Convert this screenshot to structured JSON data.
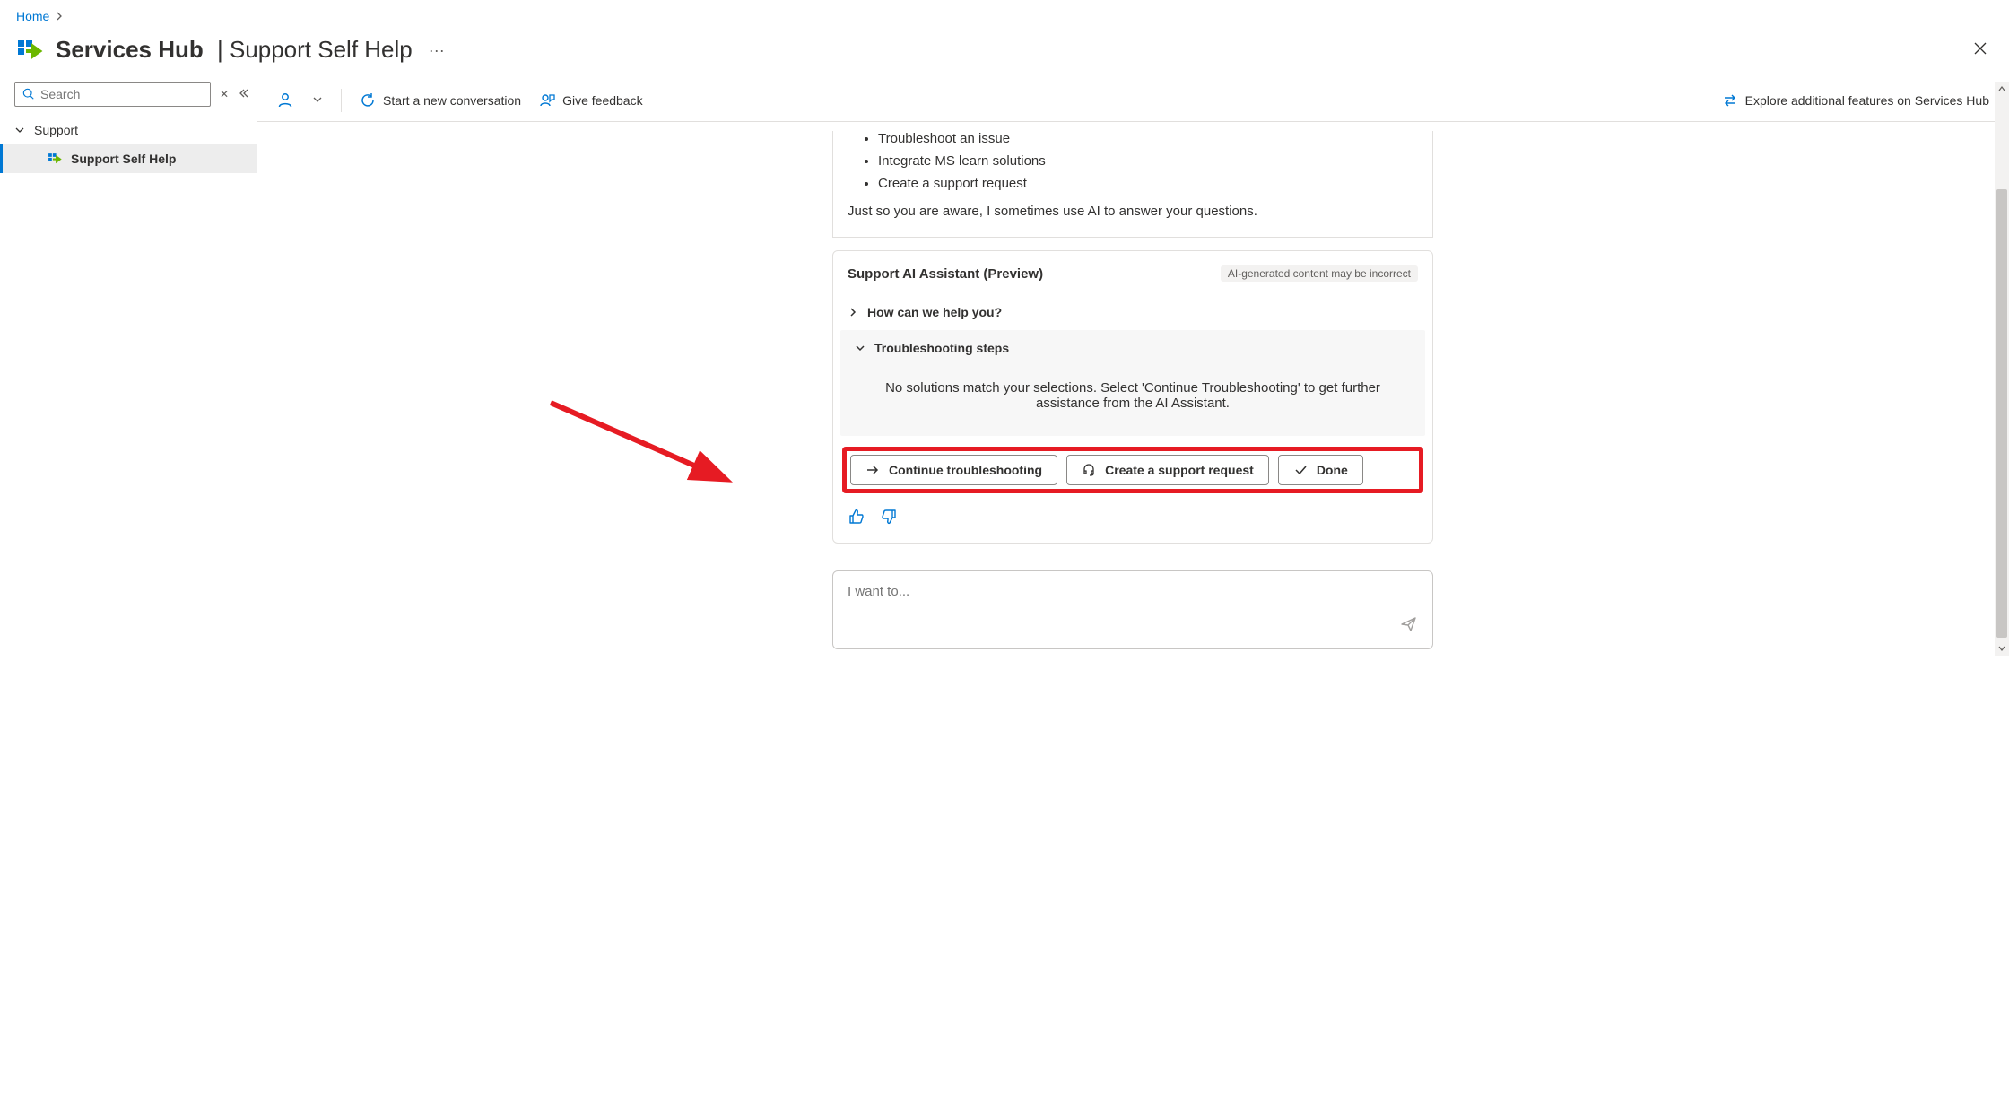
{
  "breadcrumb": {
    "home": "Home"
  },
  "header": {
    "title": "Services Hub",
    "subtitle": "Support Self Help"
  },
  "sidebar": {
    "search_placeholder": "Search",
    "group_label": "Support",
    "item_label": "Support Self Help"
  },
  "toolbar": {
    "start_conv": "Start a new conversation",
    "feedback": "Give feedback",
    "explore": "Explore additional features on Services Hub"
  },
  "intro": {
    "bullets": [
      "Troubleshoot an issue",
      "Integrate MS learn solutions",
      "Create a support request"
    ],
    "note": "Just so you are aware, I sometimes use AI to answer your questions."
  },
  "ai": {
    "title": "Support AI Assistant (Preview)",
    "disclaimer": "AI-generated content may be incorrect",
    "question_header": "How can we help you?",
    "troubleshoot_header": "Troubleshooting steps",
    "troubleshoot_body": "No solutions match your selections. Select 'Continue Troubleshooting' to get further assistance from the AI Assistant.",
    "btn_continue": "Continue troubleshooting",
    "btn_create": "Create a support request",
    "btn_done": "Done"
  },
  "input": {
    "placeholder": "I want to..."
  }
}
